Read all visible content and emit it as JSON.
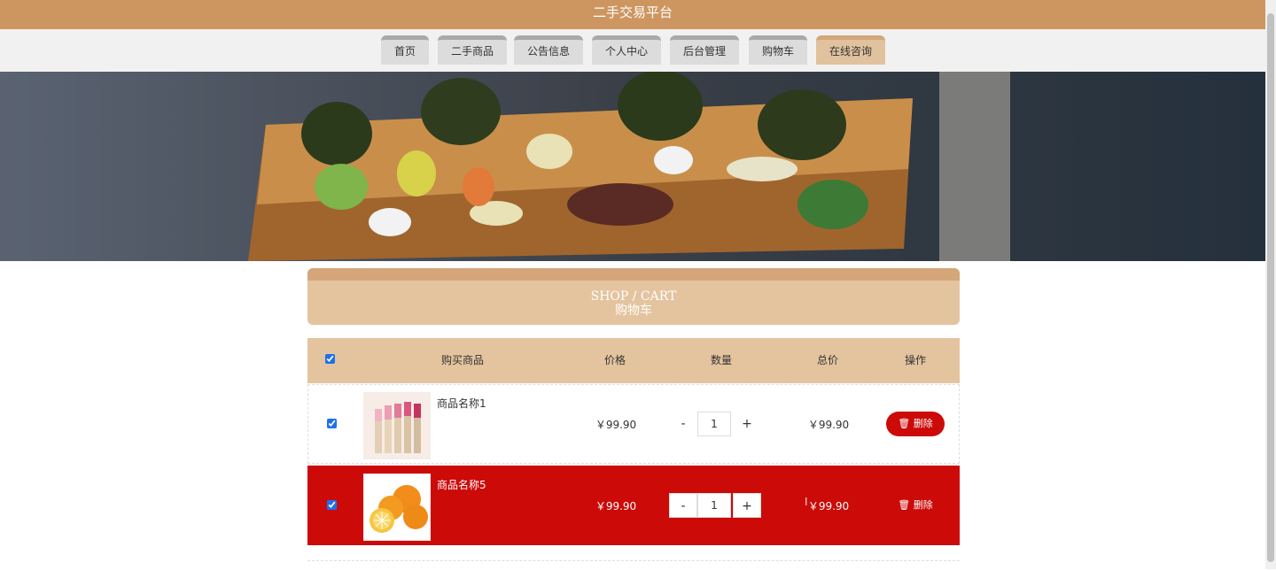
{
  "site": {
    "title": "二手交易平台"
  },
  "nav": {
    "tabs": [
      {
        "label": "首页"
      },
      {
        "label": "二手商品"
      },
      {
        "label": "公告信息"
      },
      {
        "label": "个人中心"
      },
      {
        "label": "后台管理"
      },
      {
        "label": "购物车"
      },
      {
        "label": "在线咨询"
      }
    ],
    "active_index": 6
  },
  "cart": {
    "title_en": "SHOP / CART",
    "title_zh": "购物车",
    "columns": {
      "select_all": true,
      "product": "购买商品",
      "price": "价格",
      "quantity": "数量",
      "total": "总价",
      "action": "操作"
    },
    "items": [
      {
        "checked": true,
        "name": "商品名称1",
        "image_icon": "lipstick-image",
        "price": "￥99.90",
        "qty": "1",
        "total": "￥99.90",
        "delete_label": "删除",
        "highlighted": false
      },
      {
        "checked": true,
        "name": "商品名称5",
        "image_icon": "orange-image",
        "price": "￥99.90",
        "qty": "1",
        "total": "￥99.90",
        "delete_label": "删除",
        "highlighted": true
      }
    ],
    "minus": "-",
    "plus": "+"
  },
  "colors": {
    "brand": "#cd9660",
    "header_bg": "#e4c49f",
    "highlight": "#cc0a08"
  }
}
